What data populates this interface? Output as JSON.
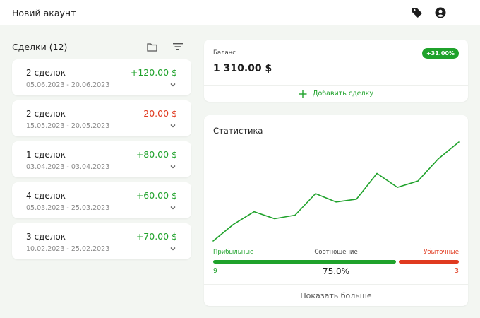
{
  "app": {
    "title": "Новий акаунт"
  },
  "header_icons": [
    "tag-icon",
    "account-icon",
    "moon-icon"
  ],
  "deals_panel": {
    "heading": "Сделки (12)",
    "tools": [
      "folder-icon",
      "filter-icon"
    ],
    "items": [
      {
        "name": "2 сделок",
        "amount": "+120.00 $",
        "dates": "05.06.2023 - 20.06.2023",
        "sign": "pos"
      },
      {
        "name": "2 сделок",
        "amount": "-20.00 $",
        "dates": "15.05.2023 - 20.05.2023",
        "sign": "neg"
      },
      {
        "name": "1 сделок",
        "amount": "+80.00 $",
        "dates": "03.04.2023 - 03.04.2023",
        "sign": "pos"
      },
      {
        "name": "4 сделок",
        "amount": "+60.00 $",
        "dates": "05.03.2023 - 25.03.2023",
        "sign": "pos"
      },
      {
        "name": "3 сделок",
        "amount": "+70.00 $",
        "dates": "10.02.2023 - 25.02.2023",
        "sign": "pos"
      }
    ]
  },
  "balance": {
    "label": "Баланс",
    "value": "1 310.00 $",
    "badge": "+31.00%",
    "add_label": "Добавить сделку"
  },
  "stats": {
    "title": "Статистика",
    "profitable_label": "Прибыльные",
    "ratio_label": "Соотношение",
    "losing_label": "Убыточные",
    "profitable_count": "9",
    "losing_count": "3",
    "ratio_value": "75.0%",
    "ratio_fraction": 0.75,
    "more_label": "Показать больше"
  },
  "colors": {
    "accent": "#1fa22b",
    "negative": "#e03a1f",
    "background": "#f3f6f2"
  },
  "chart_data": {
    "type": "line",
    "title": "",
    "xlabel": "",
    "ylabel": "",
    "grid": false,
    "x": [
      1,
      2,
      3,
      4,
      5,
      6,
      7,
      8,
      9,
      10,
      11,
      12,
      13
    ],
    "series": [
      {
        "values": [
          0,
          24,
          42,
          32,
          37,
          68,
          56,
          60,
          97,
          77,
          86,
          118,
          142
        ]
      }
    ],
    "ylim": [
      0,
      142
    ]
  }
}
